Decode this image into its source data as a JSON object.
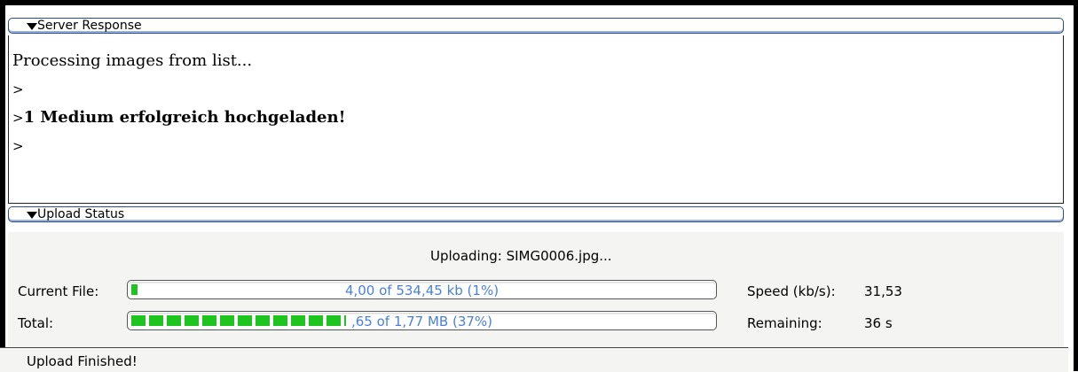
{
  "server_response": {
    "header": "Server Response",
    "lines": [
      "Processing images from list...",
      ">",
      "1 Medium erfolgreich hochgeladen!",
      ">"
    ],
    "line3_prefix": ">"
  },
  "upload_status": {
    "header": "Upload Status",
    "uploading_text": "Uploading: SIMG0006.jpg...",
    "current_file": {
      "label": "Current File:",
      "progress_text": "4,00 of 534,45 kb (1%)",
      "fraction": 0.01
    },
    "total": {
      "label": "Total:",
      "progress_text": ",65 of 1,77 MB (37%)",
      "fraction": 0.37
    },
    "speed": {
      "label": "Speed (kb/s):",
      "value": "31,53"
    },
    "remaining": {
      "label": "Remaining:",
      "value": "36 s"
    }
  },
  "status_bar": {
    "text": "Upload Finished!"
  },
  "colors": {
    "progress_fill": "#1fc51f",
    "progress_text": "#4a7fe0",
    "header_border": "#2b4f8c"
  }
}
